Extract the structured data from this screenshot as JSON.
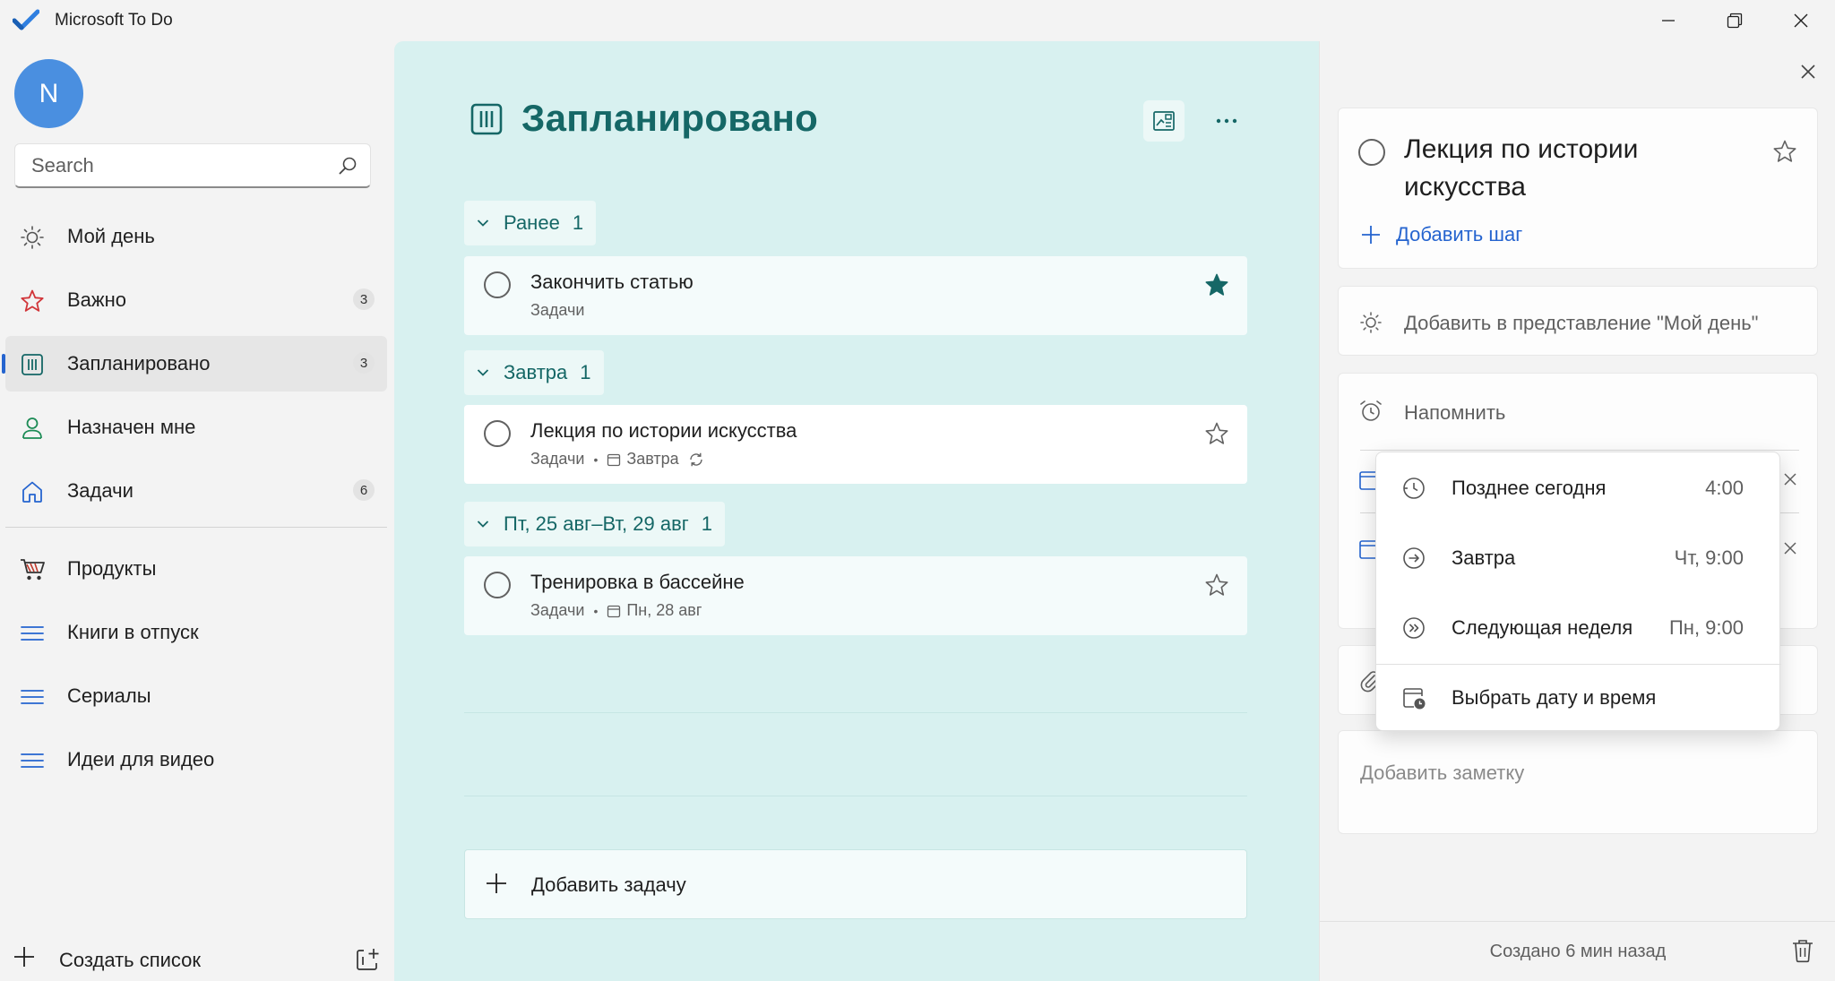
{
  "window": {
    "title": "Microsoft To Do"
  },
  "sidebar": {
    "avatar_initial": "N",
    "search_placeholder": "Search",
    "items": [
      {
        "label": "Мой день",
        "icon": "sun-icon",
        "count": ""
      },
      {
        "label": "Важно",
        "icon": "star-icon",
        "count": "3"
      },
      {
        "label": "Запланировано",
        "icon": "calendar-grid-icon",
        "count": "3"
      },
      {
        "label": "Назначен мне",
        "icon": "person-icon",
        "count": ""
      },
      {
        "label": "Задачи",
        "icon": "home-icon",
        "count": "6"
      },
      {
        "label": "Продукты",
        "icon": "shopping-cart-icon",
        "count": ""
      },
      {
        "label": "Книги в отпуск",
        "icon": "list-lines-icon",
        "count": ""
      },
      {
        "label": "Сериалы",
        "icon": "list-lines-icon",
        "count": ""
      },
      {
        "label": "Идеи для видео",
        "icon": "list-lines-icon",
        "count": ""
      }
    ],
    "new_list_label": "Создать список"
  },
  "main": {
    "title": "Запланировано",
    "groups": [
      {
        "label": "Ранее",
        "count": "1"
      },
      {
        "label": "Завтра",
        "count": "1"
      },
      {
        "label": "Пт, 25 авг–Вт, 29 авг",
        "count": "1"
      }
    ],
    "tasks": [
      {
        "title": "Закончить статью",
        "list": "Задачи",
        "due": "",
        "important": true
      },
      {
        "title": "Лекция по истории искусства",
        "list": "Задачи",
        "due": "Завтра",
        "repeat": true,
        "important": false
      },
      {
        "title": "Тренировка в бассейне",
        "list": "Задачи",
        "due": "Пн, 28 авг",
        "important": false
      }
    ],
    "add_task_label": "Добавить задачу"
  },
  "details": {
    "task_title": "Лекция по истории искусства",
    "add_step_label": "Добавить шаг",
    "add_to_my_day_label": "Добавить в представление \"Мой день\"",
    "remind_label": "Напомнить",
    "note_placeholder": "Добавить заметку",
    "created_label": "Создано 6 мин назад"
  },
  "reminder_popup": {
    "items": [
      {
        "label": "Позднее сегодня",
        "time": "4:00",
        "icon": "clock-later-icon"
      },
      {
        "label": "Завтра",
        "time": "Чт, 9:00",
        "icon": "arrow-circle-icon"
      },
      {
        "label": "Следующая неделя",
        "time": "Пн, 9:00",
        "icon": "double-arrow-circle-icon"
      },
      {
        "label": "Выбрать дату и время",
        "time": "",
        "icon": "calendar-clock-icon"
      }
    ]
  },
  "colors": {
    "accent": "#156766",
    "main_background": "#d8f1f0",
    "link_blue": "#2564cf",
    "important_red": "#d13438"
  }
}
